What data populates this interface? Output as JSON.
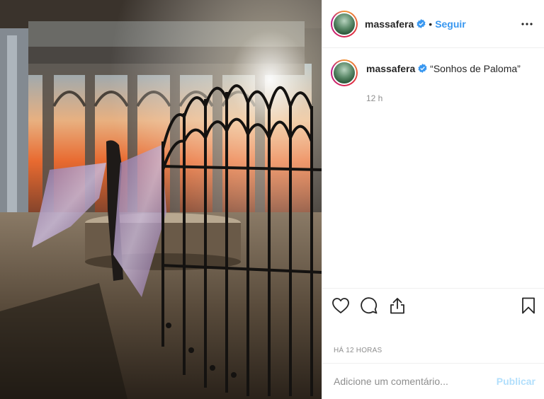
{
  "post": {
    "username": "massafera",
    "follow_label": "Seguir",
    "separator": "•",
    "verified_icon": "verified-badge-icon",
    "more_icon": "more-options-icon"
  },
  "caption": {
    "username": "massafera",
    "text": "“Sonhos de Paloma”",
    "time": "12 h"
  },
  "actions": {
    "like_icon": "heart-icon",
    "comment_icon": "comment-icon",
    "share_icon": "share-icon",
    "save_icon": "bookmark-icon"
  },
  "timestamp": "HÁ 12 HORAS",
  "comment": {
    "placeholder": "Adicione um comentário...",
    "publish_label": "Publicar"
  },
  "colors": {
    "link_blue": "#3897f0",
    "verified_blue": "#3897f0",
    "publish_disabled": "#b2dffc",
    "muted_text": "#8e8e8e",
    "border": "#efefef"
  }
}
